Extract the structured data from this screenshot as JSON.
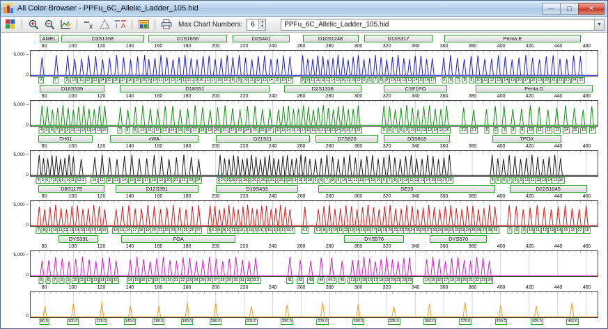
{
  "window": {
    "title": "All Color Browser - PPFu_6C_Allelic_Ladder_105.hid"
  },
  "titlebar_buttons": {
    "minimize": "—",
    "maximize": "▢",
    "close": "✕"
  },
  "toolbar": {
    "max_chart_label": "Max Chart Numbers:",
    "max_chart_value": "6",
    "file_combo_value": "PPFu_6C_Allelic_Ladder_105.hid",
    "icons": [
      "all-color",
      "zoom-in",
      "zoom-out",
      "edit-chart",
      "remove-x",
      "overlay-triangle",
      "compare-traces",
      "snapshot",
      "print"
    ]
  },
  "chart_data": [
    {
      "type": "line",
      "channel": "blue",
      "color": "#2121cc",
      "base_height": 0.8,
      "ylabel_top": "5,000",
      "ylabel_bottom": "0",
      "x_range": [
        70,
        468
      ],
      "x_ticks": [
        80,
        100,
        120,
        140,
        160,
        180,
        200,
        220,
        240,
        260,
        280,
        300,
        320,
        340,
        360,
        380,
        400,
        420,
        440,
        460
      ],
      "markers": [
        {
          "name": "AMEL",
          "start": 77,
          "end": 90
        },
        {
          "name": "D3S1358",
          "start": 92,
          "end": 150
        },
        {
          "name": "D1S1656",
          "start": 153,
          "end": 208
        },
        {
          "name": "D2S441",
          "start": 212,
          "end": 252
        },
        {
          "name": "D10S1248",
          "start": 261,
          "end": 300
        },
        {
          "name": "D13S317",
          "start": 304,
          "end": 352
        },
        {
          "name": "Penta E",
          "start": 360,
          "end": 456
        }
      ],
      "allele_groups": [
        {
          "start": 78,
          "end": 88,
          "labels": [
            "X",
            "Y"
          ]
        },
        {
          "start": 96,
          "end": 150,
          "labels": [
            "9",
            "10",
            "11",
            "12",
            "13",
            "14",
            "15",
            "16",
            "17",
            "18",
            "19",
            "20"
          ]
        },
        {
          "start": 153,
          "end": 208,
          "labels": [
            "9",
            "10",
            "11",
            "12",
            "13",
            "14",
            "15",
            "15.3",
            "16",
            "16.3",
            "17",
            "17.3",
            "18.3",
            "19.3"
          ]
        },
        {
          "start": 212,
          "end": 252,
          "labels": [
            "8",
            "9",
            "10",
            "11",
            "12",
            "13",
            "14",
            "15",
            "16",
            "17"
          ]
        },
        {
          "start": 261,
          "end": 300,
          "labels": [
            "8",
            "9",
            "10",
            "11",
            "12",
            "13",
            "14",
            "15",
            "16",
            "17",
            "18",
            "19"
          ]
        },
        {
          "start": 304,
          "end": 352,
          "labels": [
            "5",
            "6",
            "7",
            "8",
            "9",
            "10",
            "11",
            "12",
            "13",
            "14",
            "15",
            "16",
            "17"
          ]
        },
        {
          "start": 360,
          "end": 456,
          "labels": [
            "5",
            "6",
            "7",
            "8",
            "9",
            "10",
            "11",
            "12",
            "13",
            "14",
            "15",
            "16",
            "17",
            "18",
            "19",
            "20",
            "21",
            "22",
            "23",
            "24",
            "25"
          ]
        }
      ]
    },
    {
      "type": "line",
      "channel": "green",
      "color": "#169016",
      "base_height": 0.8,
      "ylabel_top": "5,000",
      "ylabel_bottom": "0",
      "x_range": [
        70,
        468
      ],
      "x_ticks": [
        80,
        100,
        120,
        140,
        160,
        180,
        200,
        220,
        240,
        260,
        280,
        300,
        320,
        340,
        360,
        380,
        400,
        420,
        440,
        460
      ],
      "markers": [
        {
          "name": "D16S539",
          "start": 77,
          "end": 122
        },
        {
          "name": "D18S51",
          "start": 133,
          "end": 238
        },
        {
          "name": "D2S1338",
          "start": 248,
          "end": 302
        },
        {
          "name": "CSF1PO",
          "start": 318,
          "end": 362
        },
        {
          "name": "Penta D",
          "start": 382,
          "end": 464
        }
      ],
      "allele_groups": [
        {
          "start": 78,
          "end": 122,
          "labels": [
            "4",
            "5",
            "6",
            "7",
            "8",
            "9",
            "10",
            "11",
            "12",
            "13",
            "14",
            "15",
            "16"
          ]
        },
        {
          "start": 133,
          "end": 238,
          "labels": [
            "7",
            "8",
            "9",
            "10",
            "11",
            "12",
            "13",
            "14",
            "15",
            "16",
            "17",
            "18",
            "19",
            "20",
            "21",
            "22",
            "23",
            "24",
            "25",
            "26",
            "27"
          ]
        },
        {
          "start": 244,
          "end": 300,
          "labels": [
            "10",
            "12",
            "14",
            "15",
            "16",
            "17",
            "18",
            "19",
            "20",
            "21",
            "22",
            "23",
            "24",
            "25",
            "26",
            "27",
            "28"
          ]
        },
        {
          "start": 318,
          "end": 362,
          "labels": [
            "5",
            "6",
            "7",
            "8",
            "9",
            "10",
            "11",
            "12",
            "13",
            "14",
            "15",
            "16"
          ]
        },
        {
          "start": 374,
          "end": 381,
          "labels": [
            "2.2",
            "3.2"
          ]
        },
        {
          "start": 390,
          "end": 464,
          "labels": [
            "5",
            "6",
            "7",
            "8",
            "9",
            "10",
            "11",
            "12",
            "13",
            "14",
            "15",
            "16",
            "17"
          ]
        }
      ]
    },
    {
      "type": "line",
      "channel": "black",
      "color": "#1c1c1c",
      "base_height": 0.82,
      "ylabel_top": "5,000",
      "ylabel_bottom": "0",
      "x_range": [
        70,
        468
      ],
      "x_ticks": [
        80,
        100,
        120,
        140,
        160,
        180,
        200,
        220,
        240,
        260,
        280,
        300,
        320,
        340,
        360,
        380,
        400,
        420,
        440,
        460
      ],
      "markers": [
        {
          "name": "TH01",
          "start": 76,
          "end": 114
        },
        {
          "name": "vWA",
          "start": 126,
          "end": 188
        },
        {
          "name": "D21S11",
          "start": 200,
          "end": 266
        },
        {
          "name": "D7S820",
          "start": 270,
          "end": 314
        },
        {
          "name": "D5S818",
          "start": 318,
          "end": 364
        },
        {
          "name": "TPOX",
          "start": 394,
          "end": 442
        }
      ],
      "allele_groups": [
        {
          "start": 76,
          "end": 100,
          "labels": [
            "4",
            "5",
            "6",
            "7",
            "8",
            "9",
            "9.3",
            "10",
            "11"
          ]
        },
        {
          "start": 104,
          "end": 107,
          "labels": [
            "13.3"
          ]
        },
        {
          "start": 115,
          "end": 188,
          "labels": [
            "10",
            "11",
            "12",
            "13",
            "14",
            "15",
            "16",
            "17",
            "18",
            "19",
            "20",
            "21",
            "22",
            "23",
            "24"
          ]
        },
        {
          "start": 203,
          "end": 266,
          "labels": [
            "24",
            "24.2",
            "25",
            "26",
            "27",
            "28",
            "28.2",
            "29",
            "29.2",
            "30",
            "30.2",
            "31",
            "31.2",
            "32",
            "32.2",
            "33",
            "33.2",
            "34",
            "35",
            "36",
            "38"
          ]
        },
        {
          "start": 270,
          "end": 314,
          "labels": [
            "5",
            "6",
            "7",
            "8",
            "9",
            "10",
            "11",
            "12",
            "13",
            "14",
            "15",
            "16"
          ]
        },
        {
          "start": 318,
          "end": 364,
          "labels": [
            "6",
            "7",
            "8",
            "9",
            "10",
            "11",
            "12",
            "13",
            "14",
            "15",
            "16",
            "17",
            "18"
          ]
        },
        {
          "start": 394,
          "end": 442,
          "labels": [
            "4",
            "5",
            "6",
            "7",
            "8",
            "9",
            "10",
            "11",
            "12",
            "13",
            "14",
            "15",
            "16"
          ]
        }
      ]
    },
    {
      "type": "line",
      "channel": "red",
      "color": "#d01f1f",
      "base_height": 0.82,
      "ylabel_top": "5,000",
      "ylabel_bottom": "0",
      "x_range": [
        70,
        468
      ],
      "x_ticks": [
        80,
        100,
        120,
        140,
        160,
        180,
        200,
        220,
        240,
        260,
        280,
        300,
        320,
        340,
        360,
        380,
        400,
        420,
        440,
        460
      ],
      "markers": [
        {
          "name": "D8S1179",
          "start": 76,
          "end": 122
        },
        {
          "name": "D12S391",
          "start": 130,
          "end": 188
        },
        {
          "name": "D19S433",
          "start": 200,
          "end": 258
        },
        {
          "name": "SE33",
          "start": 272,
          "end": 396
        },
        {
          "name": "D22S1045",
          "start": 406,
          "end": 460
        }
      ],
      "allele_groups": [
        {
          "start": 76,
          "end": 122,
          "labels": [
            "7",
            "8",
            "9",
            "10",
            "11",
            "12",
            "13",
            "14",
            "15",
            "16",
            "17",
            "18",
            "19"
          ]
        },
        {
          "start": 130,
          "end": 188,
          "labels": [
            "14",
            "15",
            "16",
            "17",
            "18",
            "19",
            "20",
            "21",
            "22",
            "23",
            "24",
            "25",
            "26",
            "27"
          ]
        },
        {
          "start": 196,
          "end": 252,
          "labels": [
            "5",
            "6.2",
            "8",
            "9",
            "10",
            "11",
            "12",
            "12.2",
            "13",
            "13.2",
            "14",
            "14.2",
            "15",
            "15.2",
            "16",
            "16.2",
            "17.2",
            "18.2"
          ]
        },
        {
          "start": 261,
          "end": 264,
          "labels": [
            "4.2"
          ]
        },
        {
          "start": 272,
          "end": 396,
          "labels": [
            "6.3",
            "8",
            "9",
            "10",
            "11",
            "12",
            "13",
            "14",
            "15",
            "16",
            "17",
            "18",
            "19",
            "20",
            "21",
            "22",
            "23",
            "24",
            "25",
            "26",
            "27",
            "28",
            "29",
            "30",
            "31",
            "32",
            "33",
            "34",
            "35",
            "36",
            "37",
            "38",
            "39"
          ]
        },
        {
          "start": 406,
          "end": 460,
          "labels": [
            "7",
            "8",
            "9",
            "10",
            "11",
            "12",
            "13",
            "14",
            "15",
            "16",
            "17",
            "18"
          ]
        }
      ]
    },
    {
      "type": "line",
      "channel": "magenta",
      "color": "#d621c4",
      "base_height": 0.74,
      "ylabel_top": "5,000",
      "ylabel_bottom": "0",
      "x_range": [
        70,
        468
      ],
      "x_ticks": [
        80,
        100,
        120,
        140,
        160,
        180,
        200,
        220,
        240,
        260,
        280,
        300,
        320,
        340,
        360,
        380,
        400,
        420,
        440,
        460
      ],
      "markers": [
        {
          "name": "DYS391",
          "start": 90,
          "end": 118
        },
        {
          "name": "FGA",
          "start": 134,
          "end": 214
        },
        {
          "name": "DYS576",
          "start": 290,
          "end": 332
        },
        {
          "name": "DYS570",
          "start": 350,
          "end": 390
        }
      ],
      "allele_groups": [
        {
          "start": 78,
          "end": 130,
          "labels": [
            "5",
            "6",
            "7",
            "8",
            "9",
            "10",
            "11",
            "12",
            "13",
            "14",
            "15",
            "16"
          ]
        },
        {
          "start": 140,
          "end": 228,
          "labels": [
            "14",
            "15",
            "16",
            "17",
            "18",
            "19",
            "20",
            "21",
            "22",
            "23",
            "24",
            "25",
            "26",
            "27",
            "28",
            "29",
            "30",
            "31",
            "32",
            "33.2"
          ]
        },
        {
          "start": 252,
          "end": 296,
          "labels": [
            "41",
            "42",
            "43",
            "44",
            "44.2",
            "45",
            "50.2"
          ]
        },
        {
          "start": 296,
          "end": 336,
          "labels": [
            "13",
            "14",
            "15",
            "16",
            "17",
            "18",
            "19",
            "20",
            "21",
            "22",
            "23"
          ]
        },
        {
          "start": 348,
          "end": 392,
          "labels": [
            "14",
            "15",
            "16",
            "17",
            "18",
            "19",
            "20",
            "21",
            "22",
            "23",
            "24"
          ]
        }
      ]
    },
    {
      "type": "line",
      "channel": "orange",
      "color": "#ef9d22",
      "base_height": 0.55,
      "ylabel_top": "",
      "ylabel_bottom": "0",
      "x_range": [
        70,
        468
      ],
      "x_ticks": [
        80,
        100,
        120,
        140,
        160,
        180,
        200,
        220,
        240,
        260,
        280,
        300,
        320,
        340,
        360,
        380,
        400,
        420,
        440,
        460
      ],
      "markers": [],
      "allele_groups": [
        {
          "start": 80,
          "end": 450,
          "labels": [
            "80.0",
            "100.0",
            "120.0",
            "140.0",
            "160.0",
            "180.0",
            "200.0",
            "225.0",
            "250.0",
            "275.0",
            "300.0",
            "325.0",
            "350.0",
            "375.0",
            "400.0",
            "425.0",
            "450.0"
          ],
          "positions": [
            80,
            100,
            120,
            140,
            160,
            180,
            200,
            225,
            250,
            275,
            300,
            325,
            350,
            375,
            400,
            425,
            450
          ]
        }
      ]
    }
  ]
}
